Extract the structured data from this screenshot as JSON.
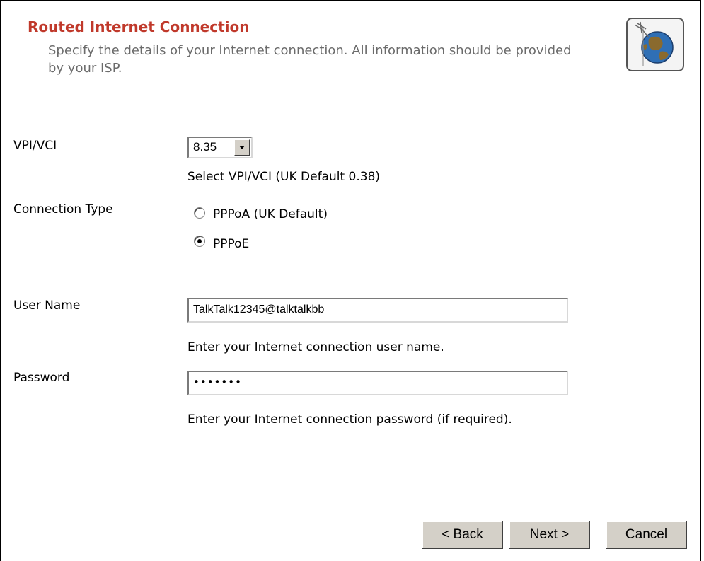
{
  "header": {
    "title": "Routed Internet Connection",
    "subtitle": "Specify the details of your Internet connection. All information should be provided by your ISP."
  },
  "vpi_vci": {
    "label": "VPI/VCI",
    "selected": "8.35",
    "help": "Select VPI/VCI (UK Default 0.38)"
  },
  "connection_type": {
    "label": "Connection Type",
    "options": [
      {
        "label": "PPPoA (UK Default)",
        "checked": false
      },
      {
        "label": "PPPoE",
        "checked": true
      }
    ]
  },
  "user_name": {
    "label": "User Name",
    "value": "TalkTalk12345@talktalkbb",
    "help": "Enter your Internet connection user name."
  },
  "password": {
    "label": "Password",
    "value": "•••••••",
    "help": "Enter your Internet connection password (if required)."
  },
  "buttons": {
    "back": "< Back",
    "next": "Next >",
    "cancel": "Cancel"
  },
  "colors": {
    "title": "#c0392b",
    "subtitle": "#6b6b6b",
    "button_face": "#d4d0c8"
  },
  "icons": {
    "logo": "globe-network-icon"
  }
}
